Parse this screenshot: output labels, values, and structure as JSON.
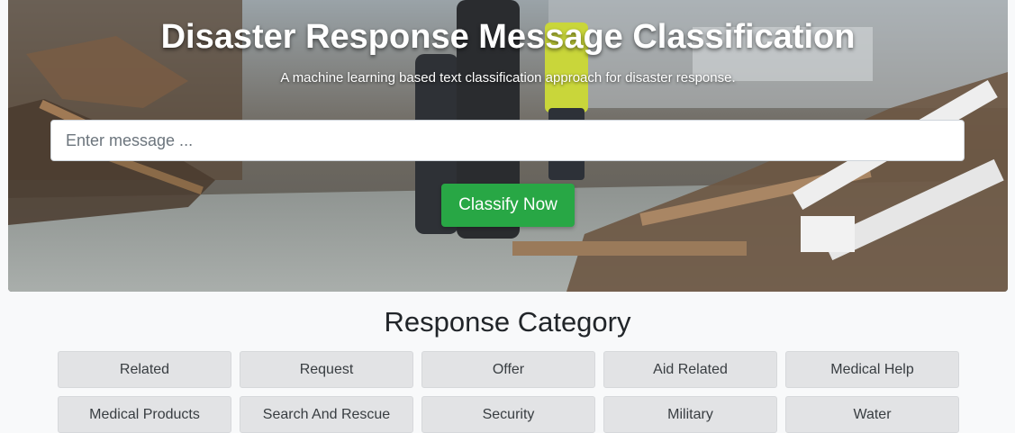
{
  "hero": {
    "title": "Disaster Response Message Classification",
    "subtitle": "A machine learning based text classification approach for disaster response.",
    "input_placeholder": "Enter message ...",
    "input_value": "",
    "classify_label": "Classify Now"
  },
  "categories": {
    "title": "Response Category",
    "items": [
      {
        "label": "Related"
      },
      {
        "label": "Request"
      },
      {
        "label": "Offer"
      },
      {
        "label": "Aid Related"
      },
      {
        "label": "Medical Help"
      },
      {
        "label": "Medical Products"
      },
      {
        "label": "Search And Rescue"
      },
      {
        "label": "Security"
      },
      {
        "label": "Military"
      },
      {
        "label": "Water"
      }
    ]
  },
  "colors": {
    "primary_button": "#28a745",
    "category_button_bg": "#e2e3e5",
    "page_bg": "#f8f9fa"
  }
}
